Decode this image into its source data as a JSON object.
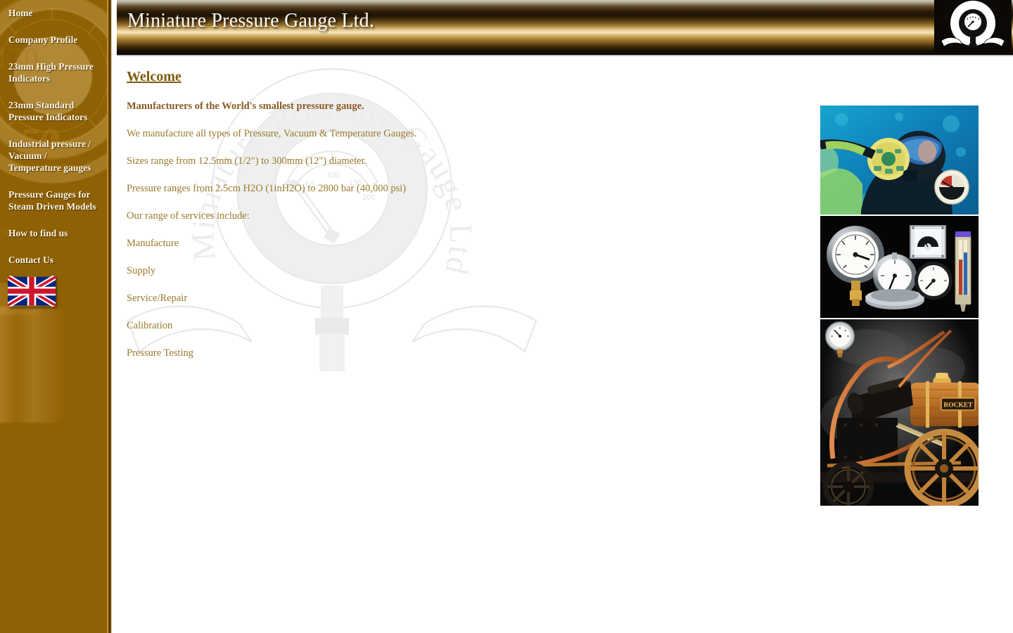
{
  "site": {
    "company": "Miniature Pressure Gauge Ltd.",
    "logo_alt": "Miniature Pressure Gauge Ltd. circular gauge emblem with ribbon",
    "watermark_text": "Miniature Pressure Gauge Ltd.",
    "accent_gold": "#8e6104",
    "header_gold": "#e1c485",
    "heading_color": "#7d5c0e",
    "body_text_color": "#9a7a2c",
    "lead_text_color": "#8a5c22",
    "nav_text_color": "#fdf6e4"
  },
  "sidebar": {
    "watermark": {
      "number": "50",
      "years": "years",
      "dial_number": "130",
      "small_label": "pr."
    },
    "items": [
      {
        "label": "Home"
      },
      {
        "label": "Company Profile"
      },
      {
        "label": "23mm High Pressure Indicators"
      },
      {
        "label": "23mm Standard Pressure Indicators"
      },
      {
        "label": "Industrial pressure / Vacuum / Temperature gauges"
      },
      {
        "label": "Pressure Gauges for Steam Driven Models"
      },
      {
        "label": "How to find us"
      },
      {
        "label": "Contact Us"
      }
    ],
    "flag": {
      "name": "union-jack-flag",
      "alt": "United Kingdom flag"
    }
  },
  "header": {
    "title": "Miniature Pressure Gauge Ltd."
  },
  "main": {
    "heading": "Welcome",
    "lead": "Manufacturers of the World's smallest pressure gauge.",
    "paragraphs": [
      "We manufacture all types of Pressure, Vacuum & Temperature Gauges.",
      "Sizes range from 12.5mm (1/2\") to 300mm (12\") diameter.",
      "Pressure ranges from 2.5cm H2O (1inH2O) to 2800 bar (40,000 psi)"
    ],
    "services_heading": "Our range of services include:",
    "services": [
      "Manufacture",
      "Supply",
      "Service/Repair",
      "Calibration",
      "Pressure Testing"
    ]
  },
  "photos": [
    {
      "name": "photo-scuba-diver",
      "alt": "Scuba diver underwater with regulator, inset dive pressure gauge"
    },
    {
      "name": "photo-gauge-collection",
      "alt": "Collection of pressure gauges and a thermometer on black background"
    },
    {
      "name": "photo-rocket-locomotive",
      "alt": "Model of the Rocket steam locomotive with inset pressure gauge",
      "label": "ROCKET"
    }
  ],
  "watermark_gauge": {
    "ticks": [
      "50",
      "100",
      "150",
      "200"
    ]
  }
}
